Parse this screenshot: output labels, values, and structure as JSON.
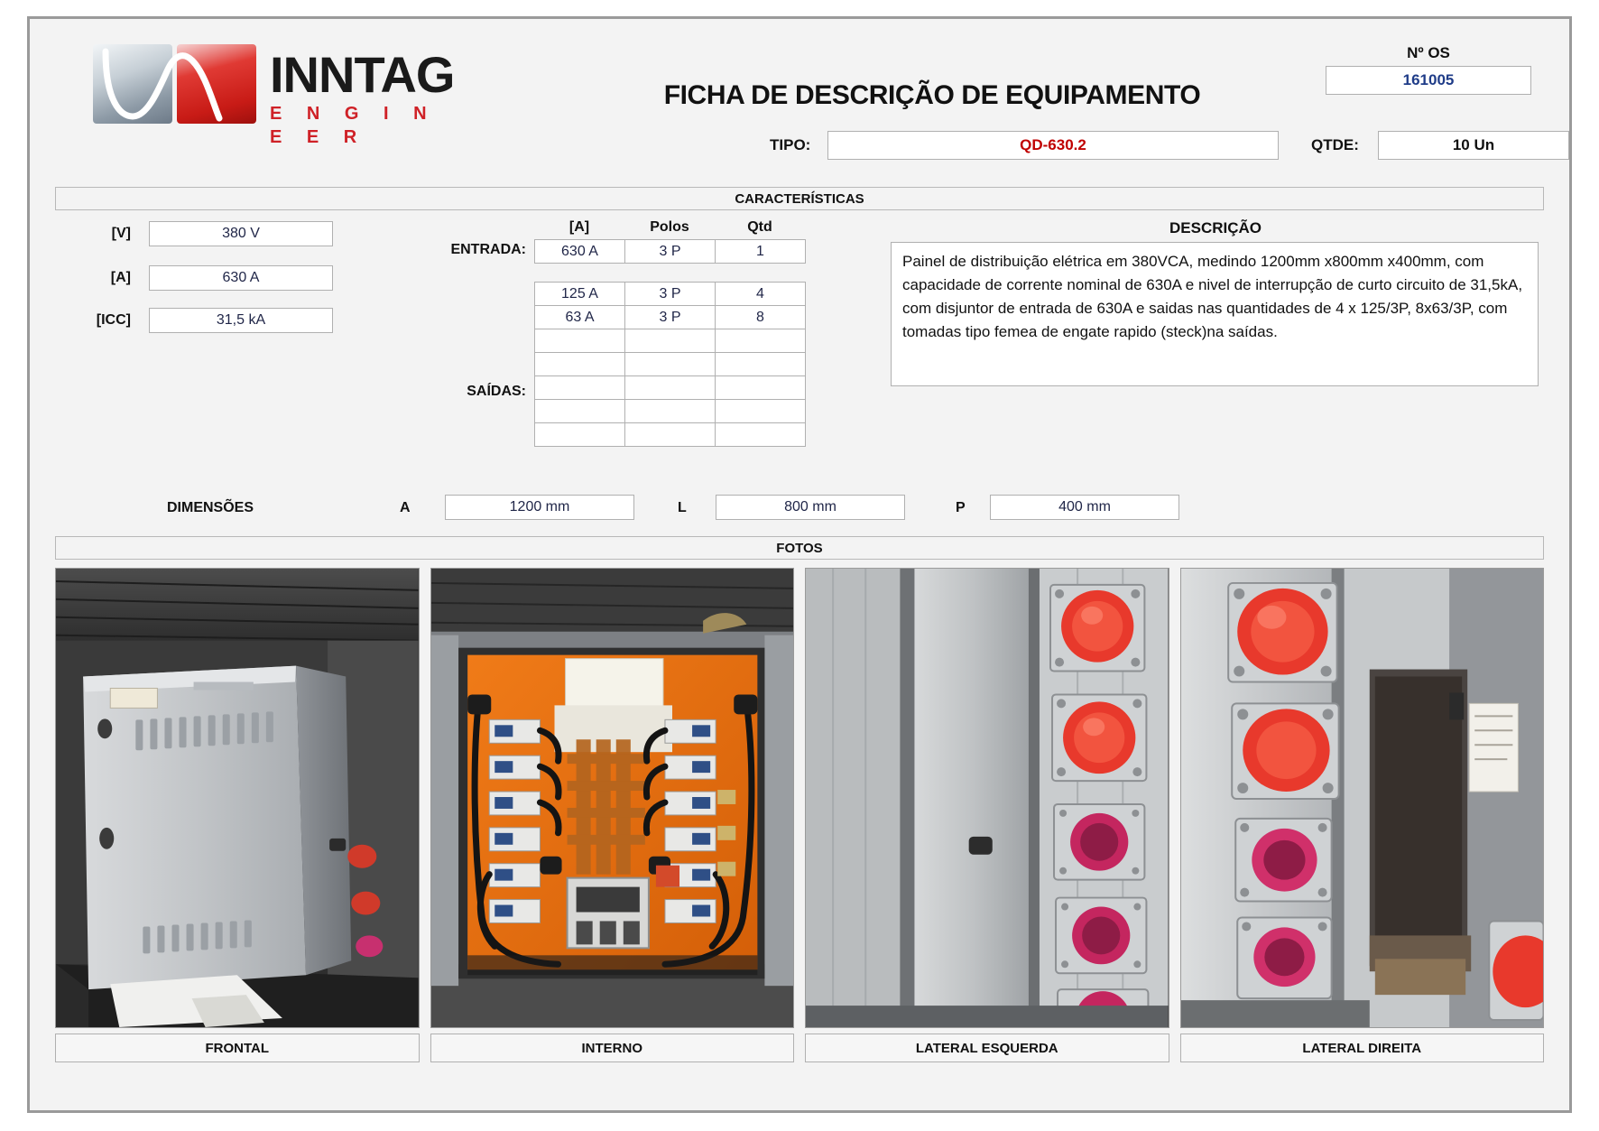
{
  "header": {
    "logo_primary": "INNTAG",
    "logo_secondary": "E N G I N E E R",
    "doc_title": "FICHA DE DESCRIÇÃO DE EQUIPAMENTO",
    "os_label": "Nº OS",
    "os_value": "161005",
    "tipo_label": "TIPO:",
    "tipo_value": "QD-630.2",
    "qtde_label": "QTDE:",
    "qtde_value": "10 Un"
  },
  "sections": {
    "caracteristicas": "CARACTERÍSTICAS",
    "fotos": "FOTOS"
  },
  "params": [
    {
      "label": "[V]",
      "value": "380 V"
    },
    {
      "label": "[A]",
      "value": "630 A"
    },
    {
      "label": "[ICC]",
      "value": "31,5 kA"
    }
  ],
  "grid": {
    "headers": [
      "[A]",
      "Polos",
      "Qtd"
    ],
    "entrada_label": "ENTRADA:",
    "entrada_rows": [
      [
        "630 A",
        "3 P",
        "1"
      ]
    ],
    "saidas_label": "SAÍDAS:",
    "saidas_rows": [
      [
        "125 A",
        "3 P",
        "4"
      ],
      [
        "63 A",
        "3 P",
        "8"
      ],
      [
        "",
        "",
        ""
      ],
      [
        "",
        "",
        ""
      ],
      [
        "",
        "",
        ""
      ],
      [
        "",
        "",
        ""
      ],
      [
        "",
        "",
        ""
      ]
    ]
  },
  "descricao": {
    "title": "DESCRIÇÃO",
    "text": "Painel de distribuição elétrica em 380VCA, medindo 1200mm x800mm x400mm, com capacidade de corrente nominal de 630A e nivel de interrupção de curto circuito de 31,5kA, com disjuntor de entrada de 630A  e saidas nas quantidades de 4 x 125/3P, 8x63/3P, com tomadas tipo femea de engate rapido (steck)na saídas."
  },
  "dimensoes": {
    "title": "DIMENSÕES",
    "items": [
      {
        "key": "A",
        "value": "1200 mm"
      },
      {
        "key": "L",
        "value": "800 mm"
      },
      {
        "key": "P",
        "value": "400 mm"
      }
    ]
  },
  "photos": [
    {
      "caption": "FRONTAL",
      "name": "photo-frontal"
    },
    {
      "caption": "INTERNO",
      "name": "photo-interno"
    },
    {
      "caption": "LATERAL ESQUERDA",
      "name": "photo-lateral-esquerda"
    },
    {
      "caption": "LATERAL DIREITA",
      "name": "photo-lateral-direita"
    }
  ],
  "colors": {
    "accent_red": "#c00000",
    "accent_blue": "#1f3c88",
    "value_text": "#1f2547",
    "panel_bg": "#f3f3f3",
    "border": "#b0b0b0",
    "logo_red": "#cf2127"
  }
}
